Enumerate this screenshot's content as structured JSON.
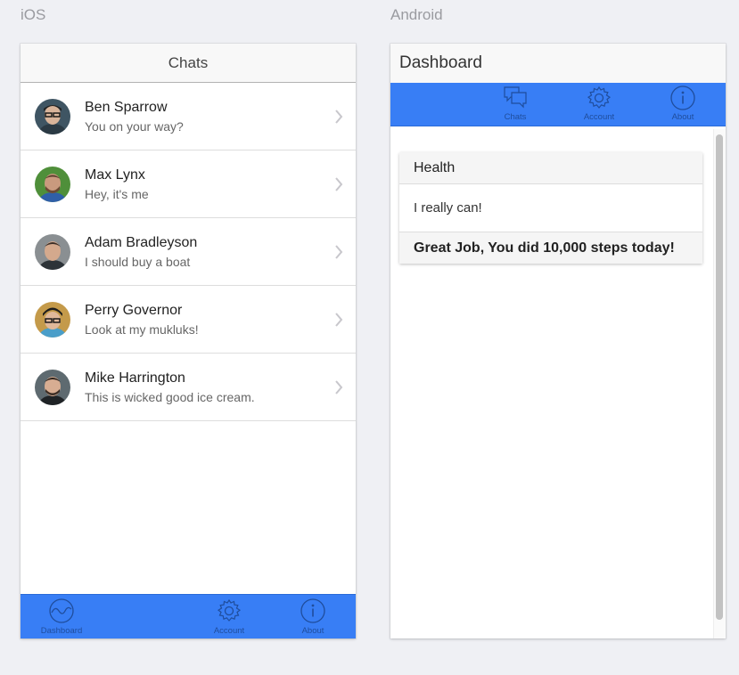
{
  "labels": {
    "ios": "iOS",
    "android": "Android"
  },
  "ios": {
    "title": "Chats",
    "chats": [
      {
        "name": "Ben Sparrow",
        "message": "You on your way?"
      },
      {
        "name": "Max Lynx",
        "message": "Hey, it's me"
      },
      {
        "name": "Adam Bradleyson",
        "message": "I should buy a boat"
      },
      {
        "name": "Perry Governor",
        "message": "Look at my mukluks!"
      },
      {
        "name": "Mike Harrington",
        "message": "This is wicked good ice cream."
      }
    ],
    "tabs": [
      {
        "label": "Dashboard",
        "icon": "pulse-icon"
      },
      {
        "label": "Account",
        "icon": "gear-icon"
      },
      {
        "label": "About",
        "icon": "info-icon"
      }
    ]
  },
  "android": {
    "title": "Dashboard",
    "tabs": [
      {
        "label": "Chats",
        "icon": "chat-bubbles-icon"
      },
      {
        "label": "Account",
        "icon": "gear-icon"
      },
      {
        "label": "About",
        "icon": "info-icon"
      }
    ],
    "card": {
      "header": "Health",
      "body": "I really can!",
      "footer": "Great Job, You did 10,000 steps today!"
    }
  },
  "colors": {
    "tabbar": "#387ef5",
    "tab_icon": "#1f4d9c"
  }
}
